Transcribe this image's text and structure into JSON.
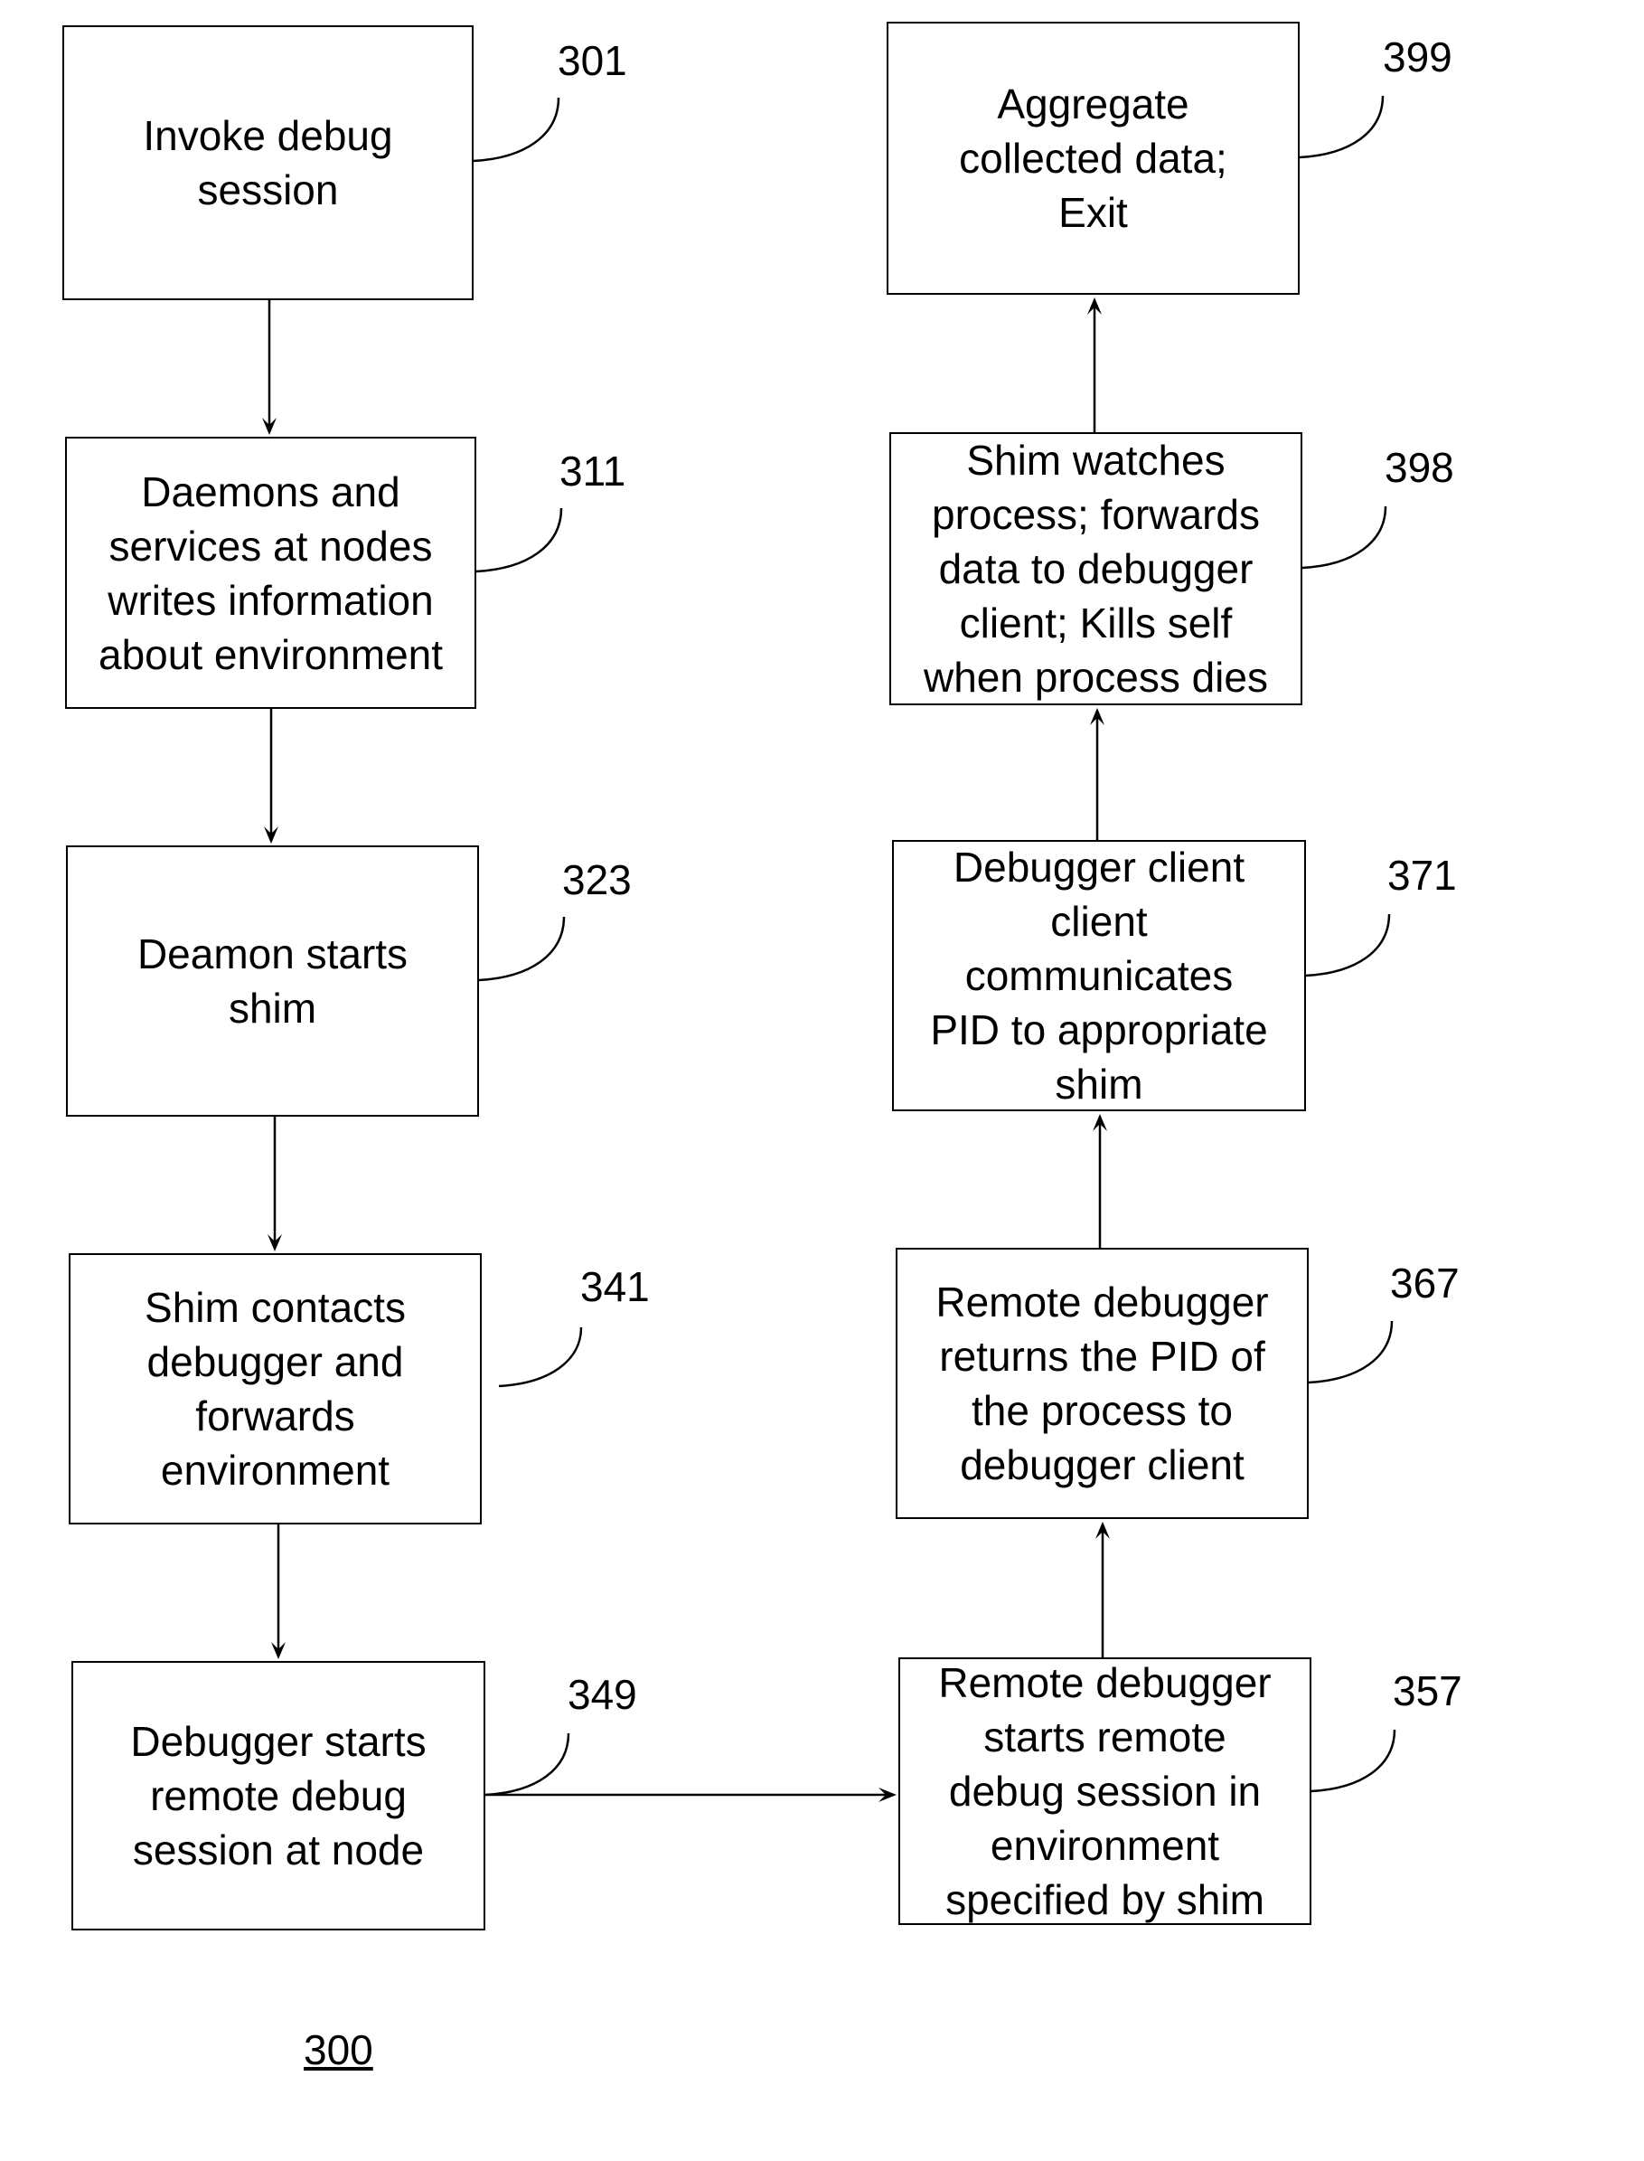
{
  "figure_label": "300",
  "steps": [
    {
      "ref": "301",
      "text": "Invoke debug\nsession"
    },
    {
      "ref": "311",
      "text": "Daemons and\nservices at nodes\nwrites information\nabout environment"
    },
    {
      "ref": "323",
      "text": "Deamon starts\nshim"
    },
    {
      "ref": "341",
      "text": "Shim contacts\ndebugger and\nforwards\nenvironment"
    },
    {
      "ref": "349",
      "text": "Debugger starts\nremote debug\nsession at node"
    },
    {
      "ref": "357",
      "text": "Remote debugger\nstarts remote\ndebug session in\nenvironment\nspecified by shim"
    },
    {
      "ref": "367",
      "text": "Remote debugger\nreturns the PID of\nthe process to\ndebugger client"
    },
    {
      "ref": "371",
      "text": "Debugger client\nclient\ncommunicates\nPID to appropriate\nshim"
    },
    {
      "ref": "398",
      "text": "Shim watches\nprocess; forwards\ndata to debugger\nclient; Kills self\nwhen process dies"
    },
    {
      "ref": "399",
      "text": "Aggregate\ncollected data;\nExit"
    }
  ]
}
